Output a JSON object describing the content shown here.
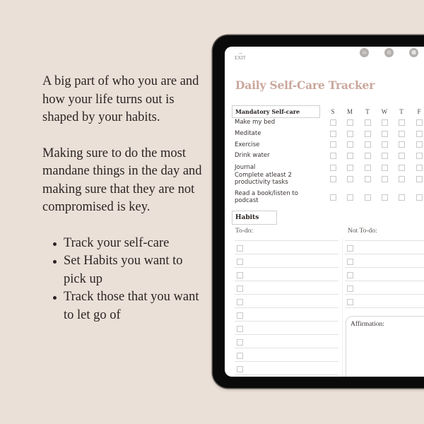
{
  "intro": {
    "paragraphs": [
      "A big part of who you are and how your life turns out is shaped by your habits.",
      "Making sure to do the most mandane things in the day and making sure that they are not compromised is key."
    ],
    "bullets": [
      "Track your self-care",
      "Set Habits you want to pick up",
      "Track those that you want to let go of"
    ]
  },
  "tablet": {
    "exit_label": "EXIT",
    "exit_arrow": "→",
    "nav_icons": [
      {
        "name": "home-icon",
        "glyph": "⌂"
      },
      {
        "name": "compass-icon",
        "glyph": "◎"
      },
      {
        "name": "calendar-icon",
        "glyph": "▦"
      }
    ],
    "title": "Daily Self-Care Tracker",
    "title_color": "#c9a79c",
    "mandatory": {
      "header": "Mandatory Self-care",
      "days": [
        "S",
        "M",
        "T",
        "W",
        "T",
        "F"
      ],
      "tasks": [
        "Make my bed",
        "Meditate",
        "Exercise",
        "Drink water",
        "Journal",
        "Complete atleast 2 productivity tasks",
        "Read a book/listen to podcast"
      ]
    },
    "habits": {
      "header": "Habits",
      "todo_label": "To-do:",
      "not_todo_label": "Not To-do:",
      "todo_rows": 10,
      "not_todo_rows": 5
    },
    "affirmation_label": "Affirmation:"
  }
}
